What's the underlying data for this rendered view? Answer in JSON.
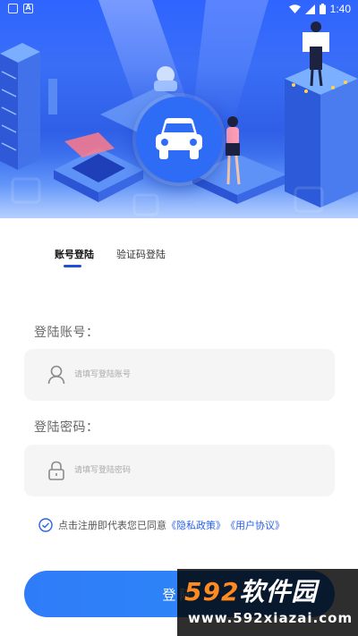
{
  "status_bar": {
    "time": "1:40",
    "left_icons": [
      "sim-icon",
      "a-notification-icon"
    ],
    "right_icons": [
      "wifi-icon",
      "signal-icon",
      "battery-icon"
    ]
  },
  "hero": {
    "icon": "car-icon",
    "colors": {
      "top": "#2f64ff",
      "bottom": "#8fb6fb",
      "badge": "#2f6cf5"
    }
  },
  "tabs": [
    {
      "label": "账号登陆",
      "active": true
    },
    {
      "label": "验证码登陆",
      "active": false
    }
  ],
  "form": {
    "account": {
      "label": "登陆账号：",
      "placeholder": "请填写登陆账号",
      "icon": "user-icon",
      "value": ""
    },
    "password": {
      "label": "登陆密码：",
      "placeholder": "请填写登陆密码",
      "icon": "lock-icon",
      "value": ""
    }
  },
  "agreement": {
    "prefix": "点击注册即代表您已同意",
    "privacy_link": "《隐私政策》",
    "terms_link": "《用户协议》",
    "checked": true,
    "icon": "check-circle-icon"
  },
  "login_button": {
    "label": "登陆"
  },
  "watermark": {
    "brand_num": "592",
    "brand_cn": "软件园",
    "url": "www.592xiazai.com"
  },
  "colors": {
    "accent": "#2a62e8",
    "button": "#2f7cf8",
    "input_bg": "#f5f5f5"
  }
}
